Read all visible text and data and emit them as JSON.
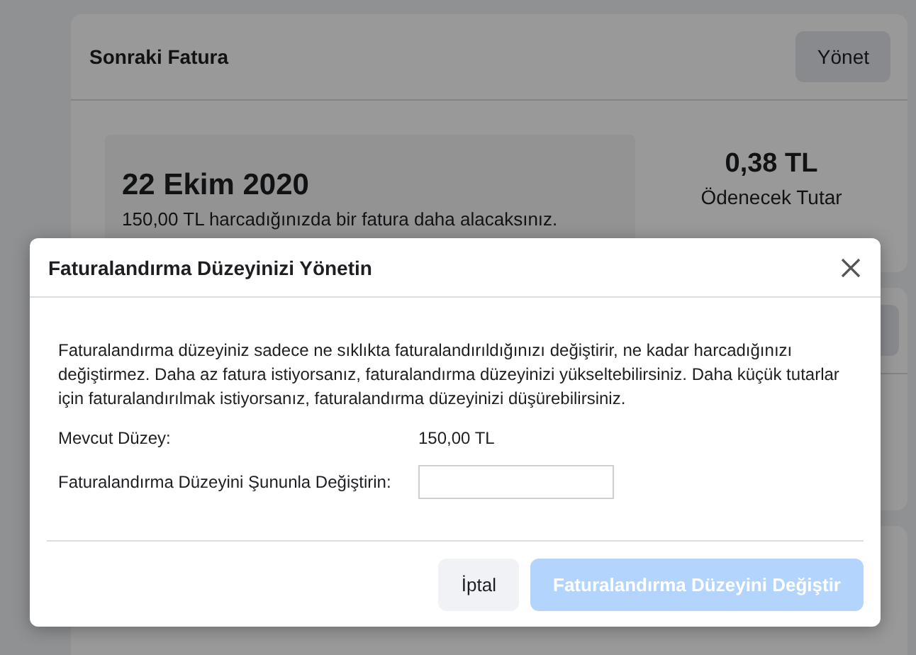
{
  "page": {
    "next_bill": {
      "title": "Sonraki Fatura",
      "manage_button": "Yönet",
      "date": "22 Ekim 2020",
      "description": "150,00 TL harcadığınızda bir fatura daha alacaksınız.",
      "amount": "0,38 TL",
      "amount_label": "Ödenecek Tutar"
    }
  },
  "dialog": {
    "title": "Faturalandırma Düzeyinizi Yönetin",
    "body": "Faturalandırma düzeyiniz sadece ne sıklıkta faturalandırıldığınızı değiştirir, ne kadar harcadığınızı değiştirmez. Daha az fatura istiyorsanız, faturalandırma düzeyinizi yükseltebilirsiniz. Daha küçük tutarlar için faturalandırılmak istiyorsanız, faturalandırma düzeyinizi düşürebilirsiniz.",
    "current_label": "Mevcut Düzey:",
    "current_value": "150,00 TL",
    "change_label": "Faturalandırma Düzeyini Şununla Değiştirin:",
    "buttons": [
      {
        "label": "İptal",
        "kind": "secondary",
        "disabled": false
      },
      {
        "label": "Faturalandırma Düzeyini Değiştir",
        "kind": "primary",
        "disabled": true
      }
    ]
  }
}
